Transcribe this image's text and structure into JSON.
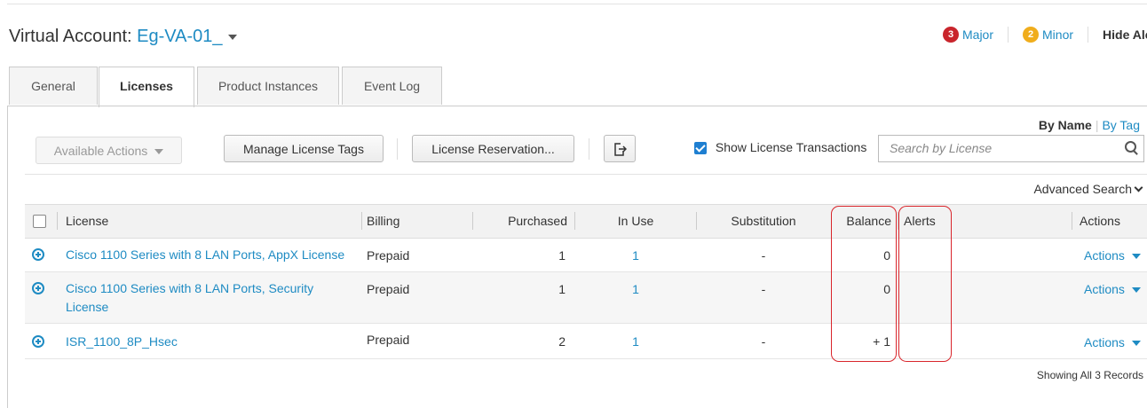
{
  "header": {
    "title_prefix": "Virtual Account:",
    "account_name": "Eg-VA-01_",
    "alerts": {
      "major_count": "3",
      "major_label": "Major",
      "minor_count": "2",
      "minor_label": "Minor",
      "hide_label": "Hide Ale"
    }
  },
  "tabs": [
    {
      "label": "General"
    },
    {
      "label": "Licenses"
    },
    {
      "label": "Product Instances"
    },
    {
      "label": "Event Log"
    }
  ],
  "active_tab": "Licenses",
  "view_toggle": {
    "by_name": "By Name",
    "by_tag": "By Tag"
  },
  "toolbar": {
    "available_actions": "Available Actions",
    "manage_tags": "Manage License Tags",
    "reservation": "License Reservation...",
    "show_transactions": "Show License Transactions",
    "show_transactions_checked": true,
    "export_icon": "export-icon"
  },
  "search": {
    "placeholder": "Search by License",
    "icon": "search-icon"
  },
  "advanced_search": "Advanced Search",
  "table": {
    "columns": [
      "License",
      "Billing",
      "Purchased",
      "In Use",
      "Substitution",
      "Balance",
      "Alerts",
      "Actions"
    ],
    "rows": [
      {
        "license": "Cisco 1100 Series with 8 LAN Ports, AppX License",
        "billing": "Prepaid",
        "purchased": "1",
        "in_use": "1",
        "substitution": "-",
        "balance": "0",
        "alerts": "",
        "actions": "Actions"
      },
      {
        "license": "Cisco 1100 Series with 8 LAN Ports, Security License",
        "billing": "Prepaid",
        "purchased": "1",
        "in_use": "1",
        "substitution": "-",
        "balance": "0",
        "alerts": "",
        "actions": "Actions"
      },
      {
        "license": "ISR_1100_8P_Hsec",
        "billing": "Prepaid",
        "purchased": "2",
        "in_use": "1",
        "substitution": "-",
        "balance": "+ 1",
        "alerts": "",
        "actions": "Actions"
      }
    ]
  },
  "footer": {
    "showing": "Showing All 3 Records"
  },
  "colors": {
    "link": "#1e8bc3",
    "major": "#c9252c",
    "minor": "#f0ad1c",
    "highlight": "#d9252b"
  }
}
